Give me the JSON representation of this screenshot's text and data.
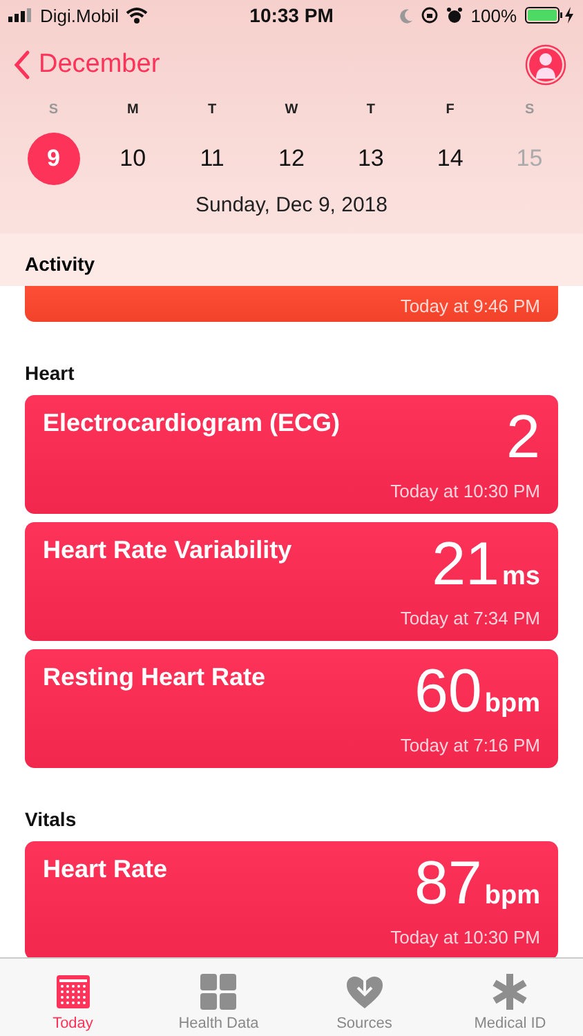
{
  "status_bar": {
    "carrier": "Digi.Mobil",
    "time": "10:33 PM",
    "battery": "100%"
  },
  "nav": {
    "back": "December"
  },
  "week": [
    {
      "letter": "S",
      "number": "9",
      "selected": true,
      "weekend": true,
      "future": false
    },
    {
      "letter": "M",
      "number": "10",
      "selected": false,
      "weekend": false,
      "future": false
    },
    {
      "letter": "T",
      "number": "11",
      "selected": false,
      "weekend": false,
      "future": false
    },
    {
      "letter": "W",
      "number": "12",
      "selected": false,
      "weekend": false,
      "future": false
    },
    {
      "letter": "T",
      "number": "13",
      "selected": false,
      "weekend": false,
      "future": false
    },
    {
      "letter": "F",
      "number": "14",
      "selected": false,
      "weekend": false,
      "future": false
    },
    {
      "letter": "S",
      "number": "15",
      "selected": false,
      "weekend": true,
      "future": true
    }
  ],
  "date": "Sunday, Dec 9, 2018",
  "sections": [
    {
      "title": "Activity",
      "cards": [
        {
          "kind": "partial",
          "color": "#fe4e36",
          "time": "Today at 9:46 PM"
        }
      ]
    },
    {
      "title": "Heart",
      "cards": [
        {
          "kind": "full",
          "color": "#fd3359",
          "title": "Electrocardiogram (ECG)",
          "value": "2",
          "time": "Today at 10:30 PM"
        },
        {
          "kind": "full",
          "color": "#fd3359",
          "title": "Heart Rate Variability",
          "value": "21",
          "unit": "ms",
          "time": "Today at 7:34 PM"
        },
        {
          "kind": "full",
          "color": "#fd3359",
          "title": "Resting Heart Rate",
          "value": "60",
          "unit": "bpm",
          "time": "Today at 7:16 PM"
        }
      ]
    },
    {
      "title": "Vitals",
      "cards": [
        {
          "kind": "full",
          "color": "#fd3359",
          "title": "Heart Rate",
          "value": "87",
          "unit": "bpm",
          "time": "Today at 10:30 PM"
        }
      ]
    }
  ],
  "tabs": [
    {
      "kind": "calendar",
      "label": "Today",
      "selected": true
    },
    {
      "kind": "grid",
      "label": "Health Data",
      "selected": false
    },
    {
      "kind": "heart",
      "label": "Sources",
      "selected": false
    },
    {
      "kind": "asterisk",
      "label": "Medical ID",
      "selected": false
    }
  ]
}
